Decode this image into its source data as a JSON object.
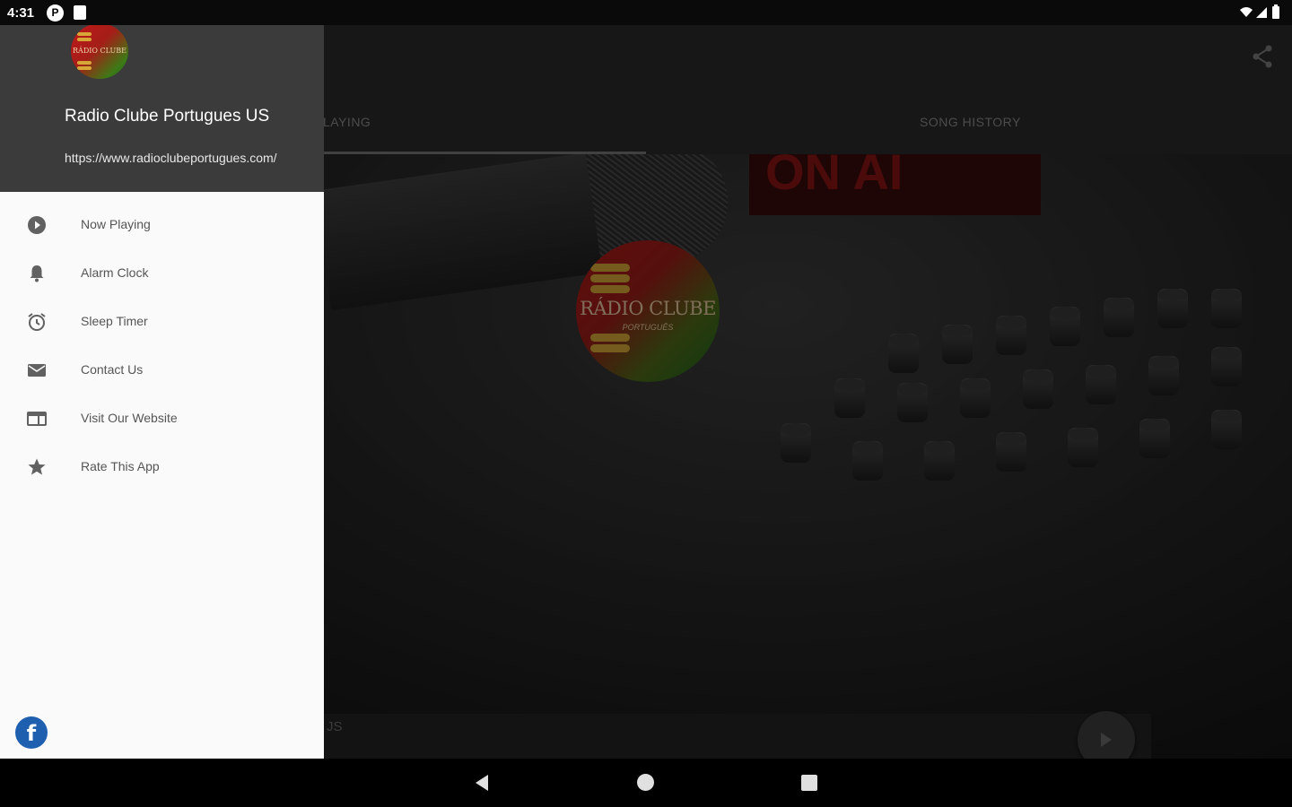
{
  "status_bar": {
    "time": "4:31",
    "left_icons": [
      "p-notification-icon",
      "sd-card-icon"
    ],
    "right_icons": [
      "wifi-icon",
      "cell-signal-icon",
      "battery-icon"
    ]
  },
  "drawer": {
    "station_title": "Radio Clube Portugues US",
    "station_url": "https://www.radioclubeportugues.com/",
    "logo_text": "RÁDIO CLUBE",
    "menu_items": [
      {
        "label": "Now Playing",
        "icon": "play-circle-icon"
      },
      {
        "label": "Alarm Clock",
        "icon": "bell-icon"
      },
      {
        "label": "Sleep Timer",
        "icon": "alarm-clock-icon"
      },
      {
        "label": "Contact Us",
        "icon": "mail-icon"
      },
      {
        "label": "Visit Our Website",
        "icon": "web-icon"
      },
      {
        "label": "Rate This App",
        "icon": "star-icon"
      }
    ],
    "facebook_label": "f"
  },
  "main": {
    "tabs": [
      {
        "label": "NOW PLAYING",
        "visible_text": "LAYING"
      },
      {
        "label": "SONG HISTORY",
        "visible_text": "SONG HISTORY"
      }
    ],
    "hero_sign_text": "ON AIR",
    "hero_sign_visible": "ON AI",
    "logo_text": "RÁDIO CLUBE",
    "logo_subtext": "PORTUGUÊS",
    "now_playing_bar_visible": "JS"
  },
  "colors": {
    "drawer_header": "#3b3b3b",
    "drawer_bg": "#fafafa",
    "facebook": "#1f5fb0",
    "logo_red": "#b01a1a",
    "logo_green": "#1a6a1f",
    "logo_gold": "#d6a736"
  }
}
